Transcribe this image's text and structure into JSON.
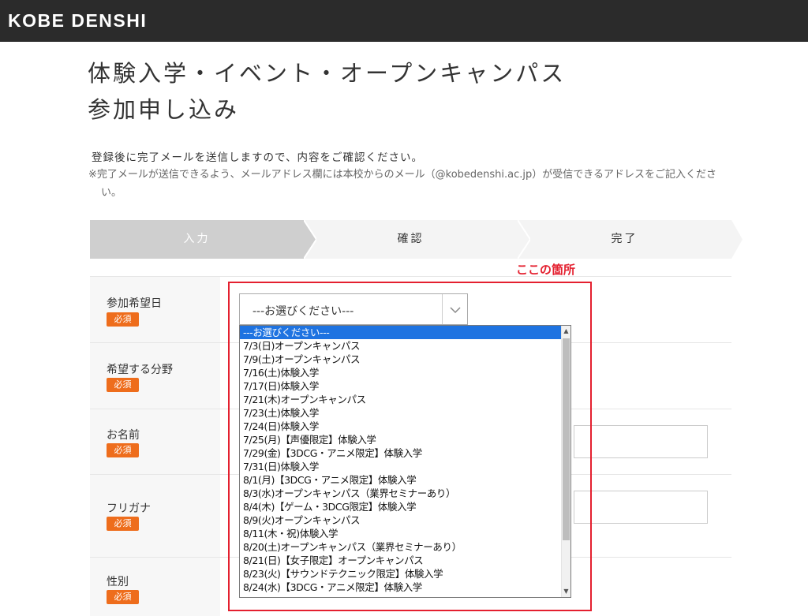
{
  "header": {
    "logo": "KOBE DENSHI"
  },
  "page": {
    "title_line1": "体験入学・イベント・オープンキャンパス",
    "title_line2": "参加申し込み",
    "notice": "登録後に完了メールを送信しますので、内容をご確認ください。",
    "sub_notice": "※完了メールが送信できるよう、メールアドレス欄には本校からのメール（@kobedenshi.ac.jp）が受信できるアドレスをご記入ください。"
  },
  "steps": [
    "入力",
    "確認",
    "完了"
  ],
  "annotation": "ここの箇所",
  "required_label": "必須",
  "fields": {
    "date": "参加希望日",
    "field": "希望する分野",
    "name": "お名前",
    "kana": "フリガナ",
    "gender": "性別"
  },
  "select": {
    "value": "---お選びください---",
    "options": [
      "---お選びください---",
      "7/3(日)オープンキャンパス",
      "7/9(土)オープンキャンパス",
      "7/16(土)体験入学",
      "7/17(日)体験入学",
      "7/21(木)オープンキャンパス",
      "7/23(土)体験入学",
      "7/24(日)体験入学",
      "7/25(月)【声優限定】体験入学",
      "7/29(金)【3DCG・アニメ限定】体験入学",
      "7/31(日)体験入学",
      "8/1(月)【3DCG・アニメ限定】体験入学",
      "8/3(水)オープンキャンパス（業界セミナーあり）",
      "8/4(木)【ゲーム・3DCG限定】体験入学",
      "8/9(火)オープンキャンパス",
      "8/11(木・祝)体験入学",
      "8/20(土)オープンキャンパス（業界セミナーあり）",
      "8/21(日)【女子限定】オープンキャンパス",
      "8/23(火)【サウンドテクニック限定】体験入学",
      "8/24(水)【3DCG・アニメ限定】体験入学"
    ]
  },
  "colors": {
    "accent": "#e4202f",
    "badge": "#ee6d1c",
    "header_bg": "#2b2b2b",
    "selected_option": "#1e73e1"
  }
}
